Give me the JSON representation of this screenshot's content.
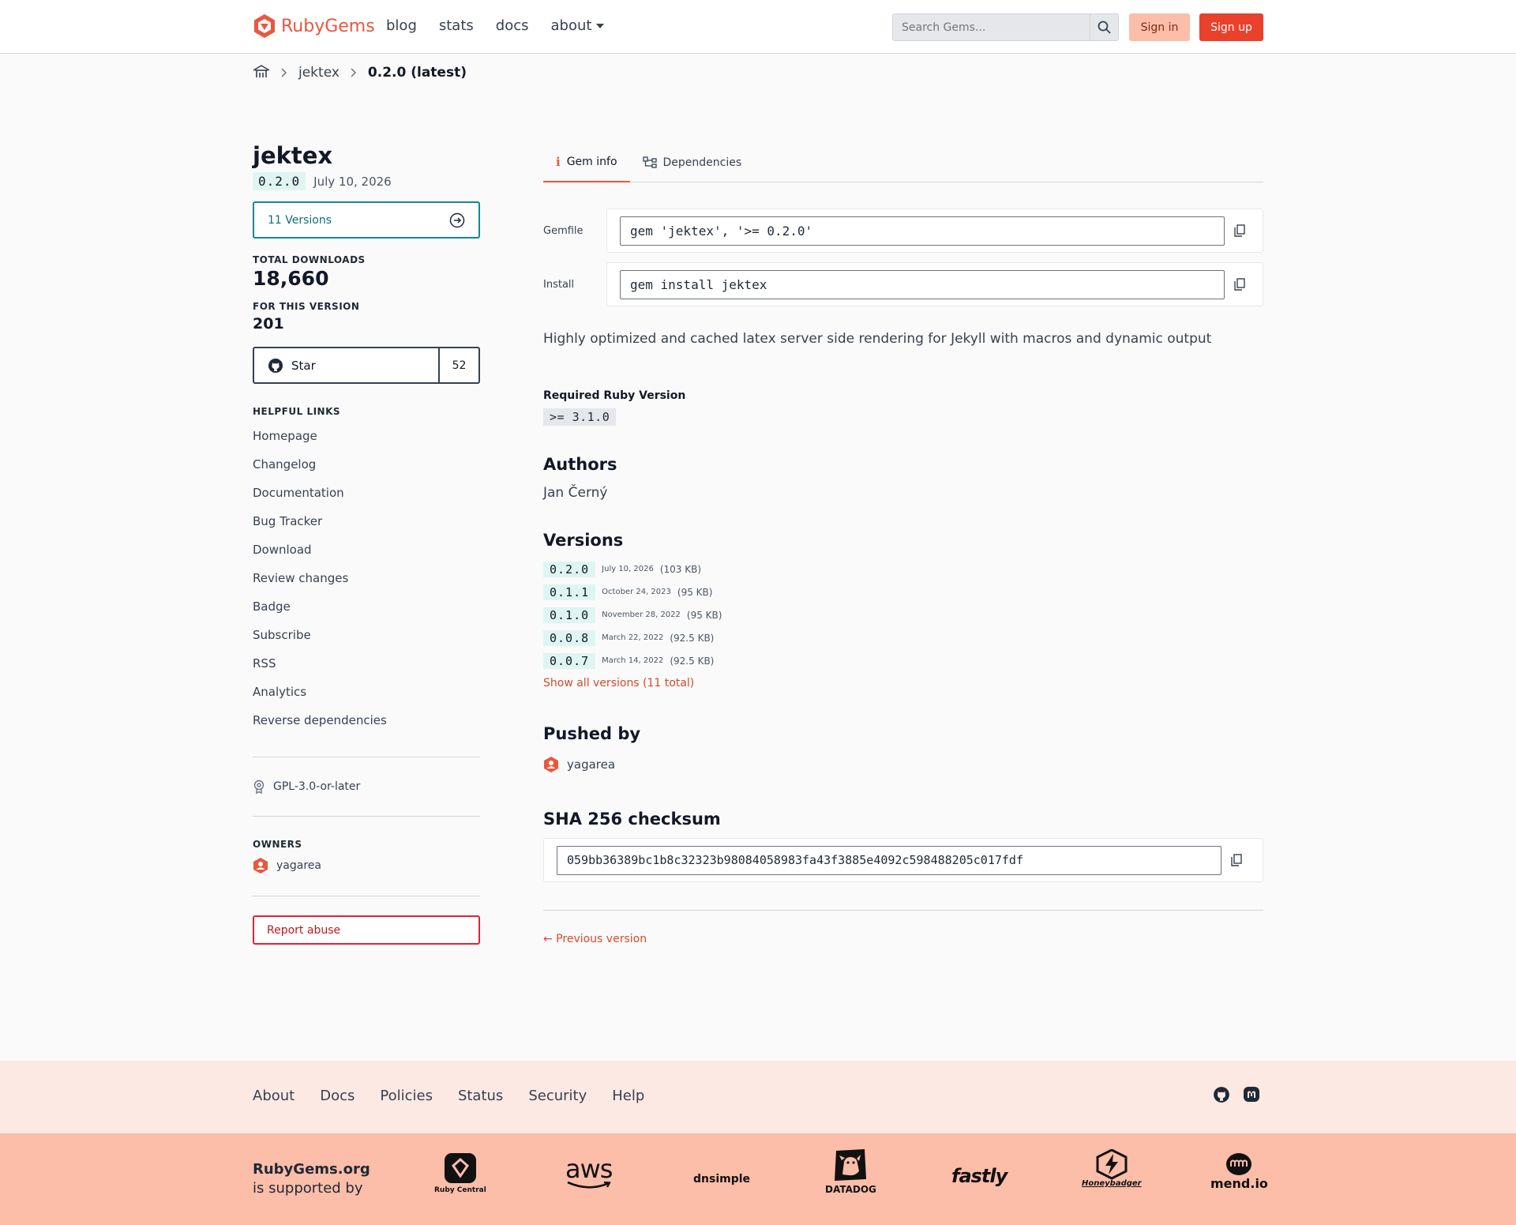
{
  "header": {
    "logo_text": "RubyGems",
    "nav": [
      "blog",
      "stats",
      "docs",
      "about"
    ],
    "search_placeholder": "Search Gems...",
    "sign_in": "Sign in",
    "sign_up": "Sign up"
  },
  "breadcrumb": {
    "gem": "jektex",
    "current": "0.2.0 (latest)"
  },
  "sidebar": {
    "gem_name": "jektex",
    "version": "0.2.0",
    "release_date": "July 10, 2026",
    "versions_button": "11 Versions",
    "total_downloads_label": "TOTAL DOWNLOADS",
    "total_downloads": "18,660",
    "version_downloads_label": "FOR THIS VERSION",
    "version_downloads": "201",
    "star_label": "Star",
    "star_count": "52",
    "helpful_links_title": "HELPFUL LINKS",
    "links": [
      "Homepage",
      "Changelog",
      "Documentation",
      "Bug Tracker",
      "Download",
      "Review changes",
      "Badge",
      "Subscribe",
      "RSS",
      "Analytics",
      "Reverse dependencies"
    ],
    "license": "GPL-3.0-or-later",
    "owners_title": "OWNERS",
    "owner": "yagarea",
    "report_abuse": "Report abuse"
  },
  "main": {
    "tabs": [
      {
        "label": "Gem info",
        "active": true
      },
      {
        "label": "Dependencies",
        "active": false
      }
    ],
    "gemfile_label": "Gemfile",
    "gemfile_cmd": "gem 'jektex', '>= 0.2.0'",
    "install_label": "Install",
    "install_cmd": "gem install jektex",
    "description": "Highly optimized and cached latex server side rendering for Jekyll with macros and dynamic output",
    "required_ruby_title": "Required Ruby Version",
    "required_ruby": ">= 3.1.0",
    "authors_title": "Authors",
    "authors": "Jan Černý",
    "versions_title": "Versions",
    "versions": [
      {
        "number": "0.2.0",
        "date": "July 10, 2026",
        "size": "(103 KB)"
      },
      {
        "number": "0.1.1",
        "date": "October 24, 2023",
        "size": "(95 KB)"
      },
      {
        "number": "0.1.0",
        "date": "November 28, 2022",
        "size": "(95 KB)"
      },
      {
        "number": "0.0.8",
        "date": "March 22, 2022",
        "size": "(92.5 KB)"
      },
      {
        "number": "0.0.7",
        "date": "March 14, 2022",
        "size": "(92.5 KB)"
      }
    ],
    "show_all": "Show all versions (11 total)",
    "pushed_by_title": "Pushed by",
    "pushed_by": "yagarea",
    "sha_title": "SHA 256 checksum",
    "sha": "059bb36389bc1b8c32323b98084058983fa43f3885e4092c598488205c017fdf",
    "previous_version": "← Previous version"
  },
  "footer": {
    "links": [
      "About",
      "Docs",
      "Policies",
      "Status",
      "Security",
      "Help"
    ],
    "supported_org": "RubyGems.org",
    "supported_by": "is supported by",
    "sponsors": [
      "Ruby Central",
      "aws",
      "dnsimple",
      "DATADOG",
      "fastly",
      "Honeybadger",
      "mend.io"
    ]
  },
  "colors": {
    "brand": "#e9573f",
    "signup": "#e9412c",
    "signin": "#fcbda9",
    "teal": "#0f8a92",
    "version_pill": "#dff5f1",
    "footer_top": "#fde9e3",
    "footer_bottom": "#fcbda9",
    "report": "#dc2635"
  }
}
